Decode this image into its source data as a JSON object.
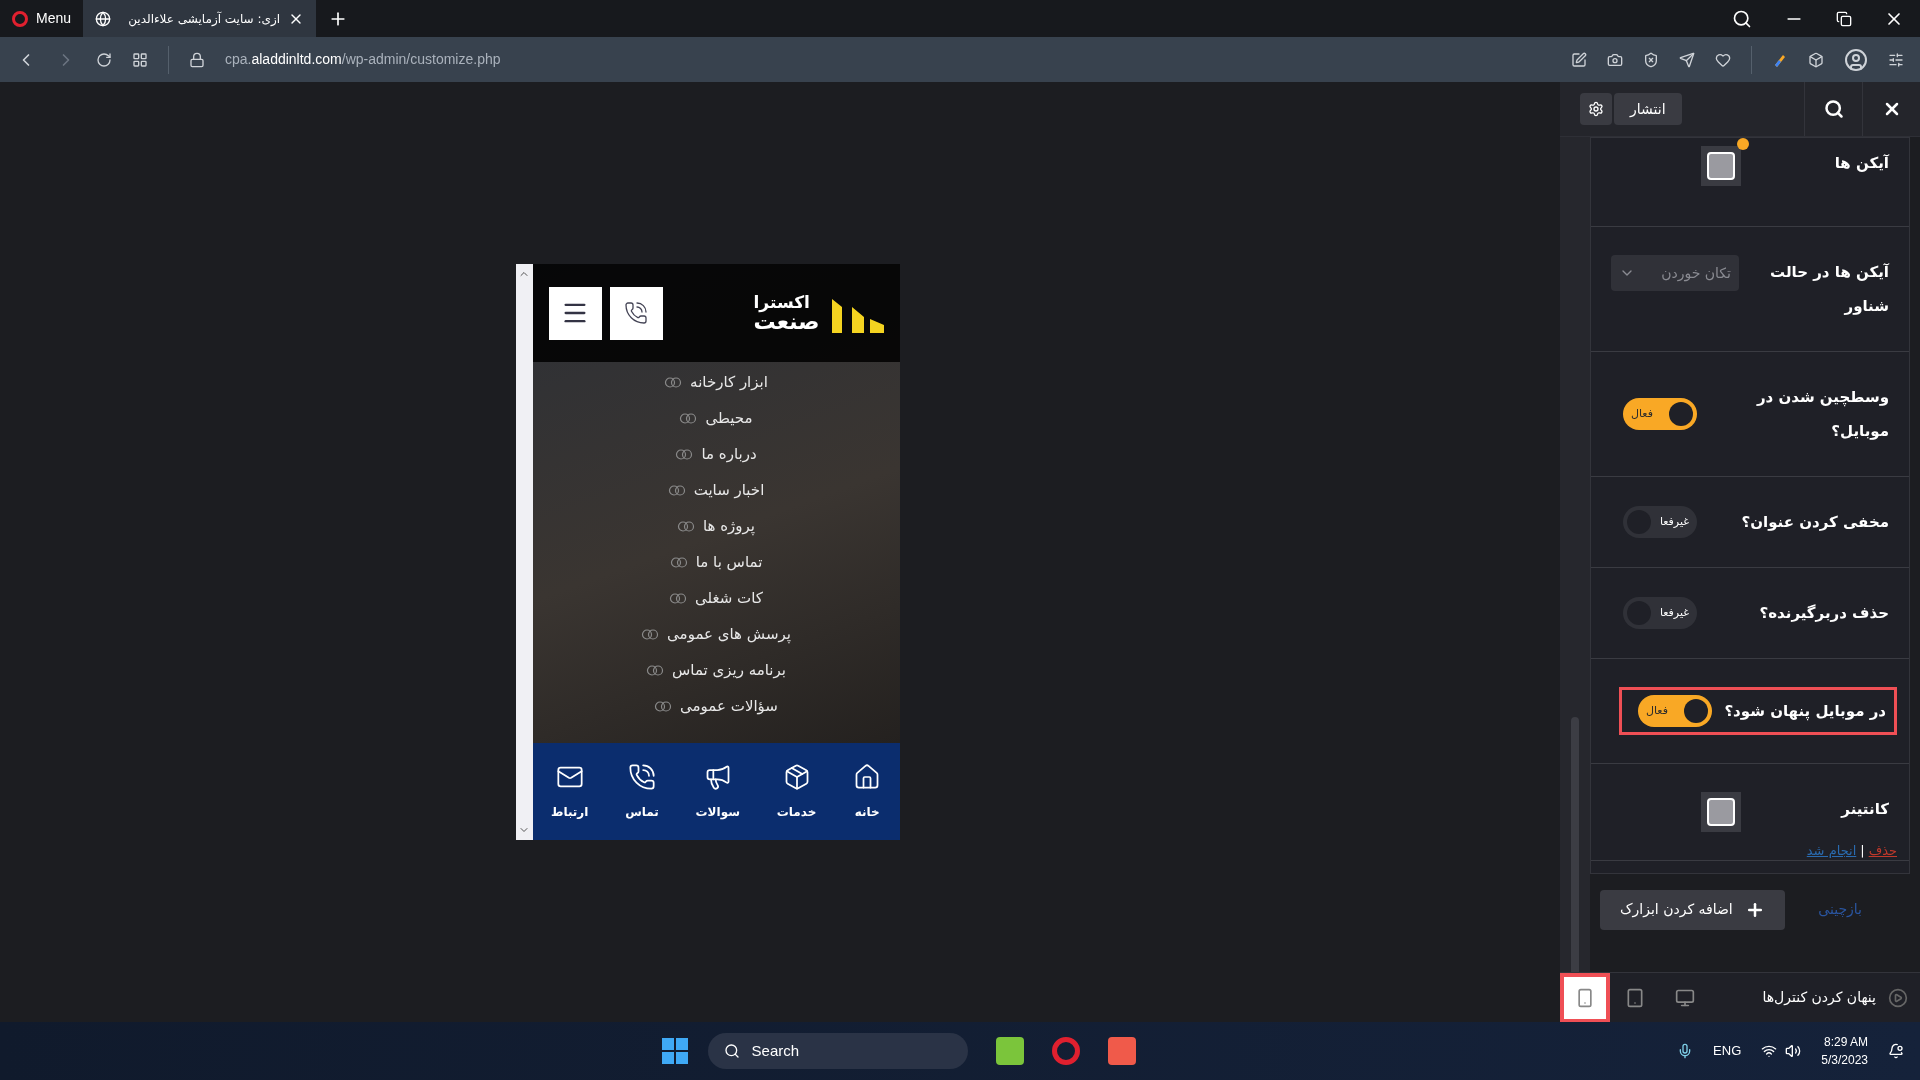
{
  "browser": {
    "menu_label": "Menu",
    "tabs": [
      {
        "title": "ازی: سایت آزمایشی علاءالدین",
        "selected": true
      }
    ],
    "address": {
      "host_prefix": "cpa.",
      "host": "aladdinltd.com",
      "path": "/wp-admin/customize.php"
    }
  },
  "preview": {
    "logo": {
      "line_1": "اکسترا",
      "line_2": "صنعت"
    },
    "menu_items": [
      {
        "label": "ابزار کارخانه"
      },
      {
        "label": "محیطی"
      },
      {
        "label": "درباره ما"
      },
      {
        "label": "اخبار سایت"
      },
      {
        "label": "پروژه ها"
      },
      {
        "label": "تماس با ما"
      },
      {
        "label": "کات شغلی"
      },
      {
        "label": "پرسش های عمومی"
      },
      {
        "label": "برنامه ریزی تماس"
      },
      {
        "label": "سؤالات عمومی"
      }
    ],
    "bottom_nav": [
      {
        "label": "خانه",
        "kind": "home"
      },
      {
        "label": "خدمات",
        "kind": "services"
      },
      {
        "label": "سوالات",
        "kind": "faq"
      },
      {
        "label": "تماس",
        "kind": "call"
      },
      {
        "label": "ارتباط",
        "kind": "contact"
      }
    ]
  },
  "panel": {
    "publish_label": "انتشار",
    "controls": [
      {
        "kind": "swatch",
        "label": "آیکن ها",
        "modified": true
      },
      {
        "kind": "select",
        "label": "آیکن ها در حالت شناور",
        "value": "تکان خوردن"
      },
      {
        "kind": "toggle",
        "label": "وسطچین شدن در موبایل؟",
        "on": true,
        "state_label": "فعال",
        "highlighted": false
      },
      {
        "kind": "toggle",
        "label": "مخفی کردن عنوان؟",
        "on": false,
        "state_label": "غیرفعا",
        "highlighted": false
      },
      {
        "kind": "toggle",
        "label": "حذف دربرگیرنده؟",
        "on": false,
        "state_label": "غیرفعا",
        "highlighted": false
      },
      {
        "kind": "toggle",
        "label": "در موبایل پنهان شود؟",
        "on": true,
        "state_label": "فعال",
        "highlighted": true
      },
      {
        "kind": "swatch",
        "label": "کانتینر",
        "modified": false
      }
    ],
    "links": [
      {
        "label": "حذف",
        "kind": "danger"
      },
      {
        "label": "انجام شد",
        "kind": "primary"
      }
    ],
    "link_separator": "|",
    "add_widget_label": "اضافه کردن ابزارک",
    "reorder_label": "بازچینی",
    "footer": {
      "hide_controls_label": "پنهان کردن کنترل‌ها",
      "devices": [
        {
          "kind": "desktop",
          "selected": false,
          "highlighted": false
        },
        {
          "kind": "tablet",
          "selected": false,
          "highlighted": false
        },
        {
          "kind": "mobile",
          "selected": true,
          "highlighted": true
        }
      ]
    }
  },
  "taskbar": {
    "search_label": "Search",
    "language": "ENG",
    "time": "8:29 AM",
    "date": "5/3/2023"
  }
}
